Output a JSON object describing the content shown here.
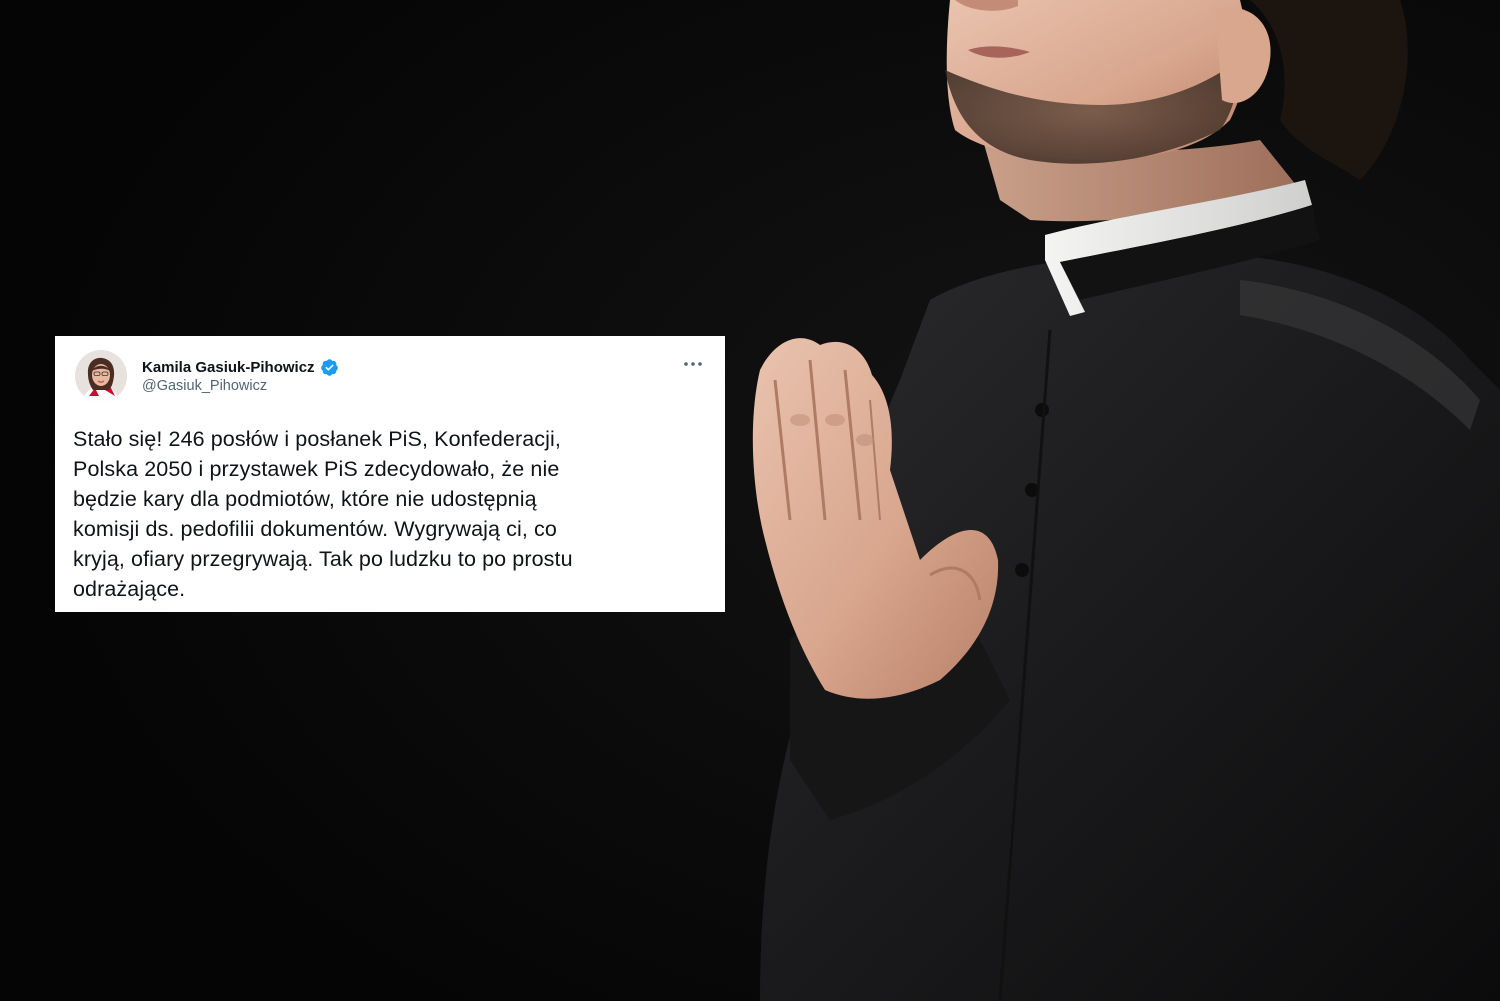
{
  "tweet": {
    "author_name": "Kamila Gasiuk-Pihowicz",
    "author_handle": "@Gasiuk_Pihowicz",
    "verified": true,
    "verified_icon": "verified-badge-icon",
    "more_icon": "more-options-icon",
    "avatar_icon": "author-avatar",
    "text": "Stało się! 246 posłów i posłanek PiS, Konfederacji,\nPolska 2050 i przystawek PiS zdecydowało, że nie\nbędzie kary dla podmiotów, które nie udostępnią\nkomisji ds. pedofilii dokumentów. Wygrywają ci, co\nkryją, ofiary przegrywają. Tak po ludzku to po prostu\nodrażające."
  },
  "colors": {
    "background": "#070707",
    "card": "#ffffff",
    "verified_blue": "#1d9bf0",
    "text_primary": "#0f1419",
    "text_secondary": "#536471"
  }
}
